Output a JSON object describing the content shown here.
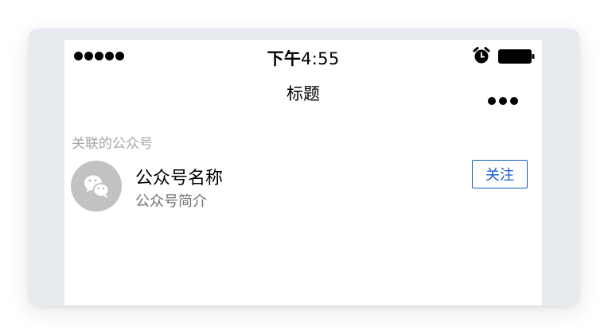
{
  "status_bar": {
    "signal": "signal-dots-icon",
    "time_prefix": "下午",
    "time": "4:55",
    "alarm": "alarm-icon",
    "battery": "battery-icon"
  },
  "nav": {
    "title": "标题",
    "more": "more-dots-icon"
  },
  "section": {
    "header": "关联的公众号"
  },
  "account": {
    "avatar_icon": "wechat-icon",
    "name": "公众号名称",
    "description": "公众号简介",
    "follow_label": "关注"
  },
  "colors": {
    "accent": "#1a5cc7",
    "avatar_bg": "#c2c2c2",
    "secondary_text": "#737373",
    "section_text": "#a6a6a6",
    "frame_bg": "#e7eaef"
  }
}
